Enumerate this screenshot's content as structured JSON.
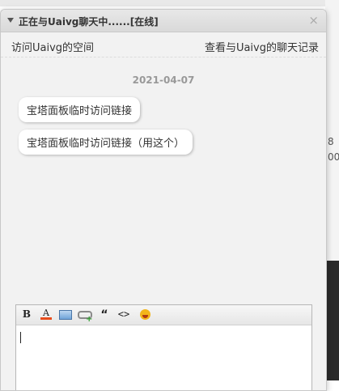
{
  "chat_window": {
    "title": "正在与Uaivg聊天中......[在线]",
    "close_symbol": "×",
    "visit_space_link": "访问Uaivg的空间",
    "history_link": "查看与Uaivg的聊天记录"
  },
  "messages": {
    "date": "2021-04-07",
    "items": [
      {
        "text": "宝塔面板临时访问链接"
      },
      {
        "text": "宝塔面板临时访问链接（用这个）"
      }
    ]
  },
  "editor": {
    "toolbar": {
      "bold_label": "B",
      "font_color_label": "A",
      "quote_label": "“",
      "code_label": "<>"
    },
    "icons": [
      "bold-icon",
      "font-color-icon",
      "image-icon",
      "link-icon",
      "quote-icon",
      "code-icon",
      "emoji-icon"
    ],
    "value": ""
  },
  "background": {
    "right_digits": [
      "8",
      "00"
    ]
  },
  "colors": {
    "titlebar": "#dedede",
    "window_bg": "#f2f2f2",
    "bubble_bg": "#ffffff",
    "date_text": "#999999",
    "font_color_swatch": "#e74c1c"
  }
}
